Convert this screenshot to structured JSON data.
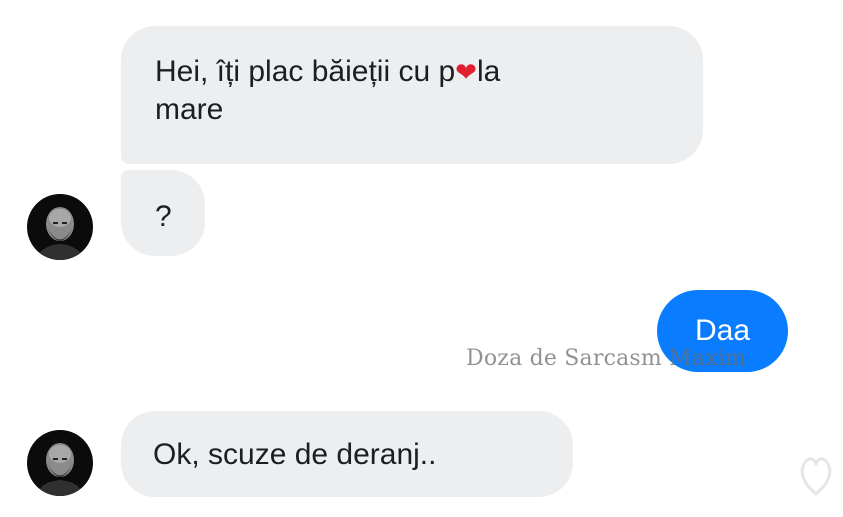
{
  "messages": {
    "first_received_line1_before": "Hei, îți plac băieții cu p",
    "first_received_heart": "❤",
    "first_received_line1_after": "la",
    "first_received_line2": "mare",
    "second_received": "?",
    "sent_reply": "Daa",
    "third_received": "Ok, scuze de deranj.."
  },
  "watermark": "Doza de Sarcasm Maxim",
  "colors": {
    "received_bubble": "#eceef0",
    "sent_bubble": "#0a7cff",
    "heart": "#e0202e"
  },
  "icons": {
    "avatar": "avatar-portrait-icon",
    "corner_mark": "heart-outline-icon"
  }
}
